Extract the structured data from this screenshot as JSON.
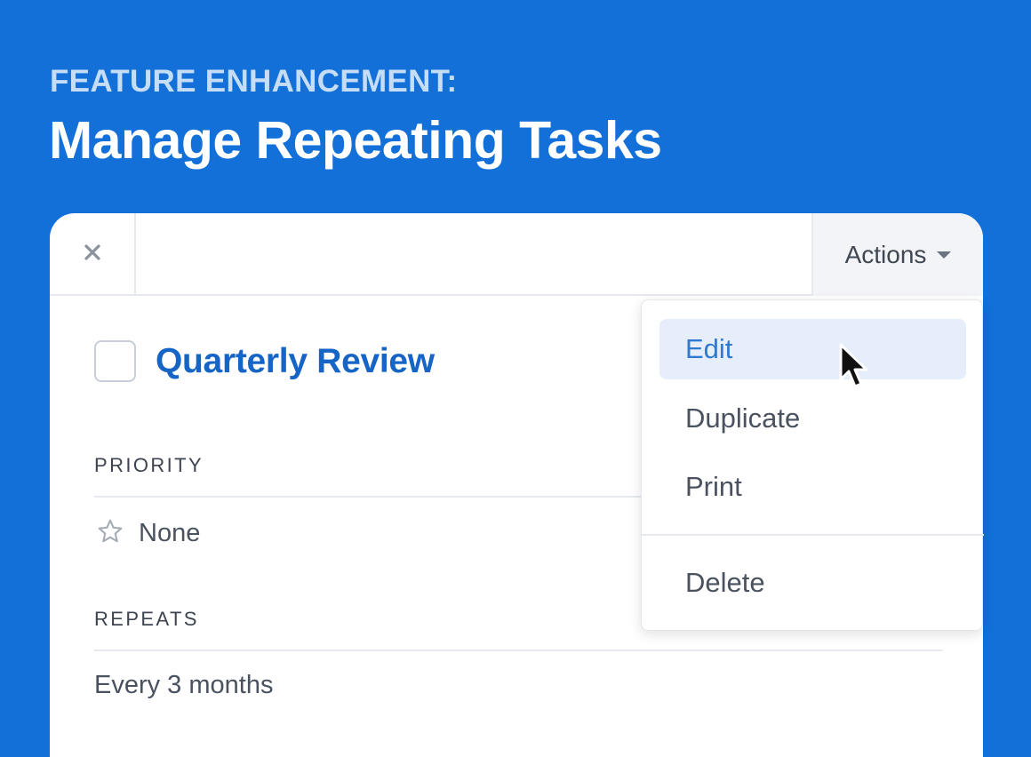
{
  "header": {
    "eyebrow": "FEATURE ENHANCEMENT:",
    "title": "Manage Repeating Tasks"
  },
  "toolbar": {
    "close_icon": "close-icon",
    "actions_label": "Actions"
  },
  "task": {
    "title": "Quarterly Review",
    "completed": false
  },
  "fields": {
    "priority_label": "PRIORITY",
    "priority_value": "None",
    "repeats_label": "REPEATS",
    "repeats_value": "Every 3 months"
  },
  "actions_menu": {
    "items": [
      "Edit",
      "Duplicate",
      "Print",
      "Delete"
    ],
    "hovered": "Edit"
  },
  "colors": {
    "background": "#1270d8",
    "accent": "#1564c6",
    "menu_highlight": "#e5eefa"
  }
}
